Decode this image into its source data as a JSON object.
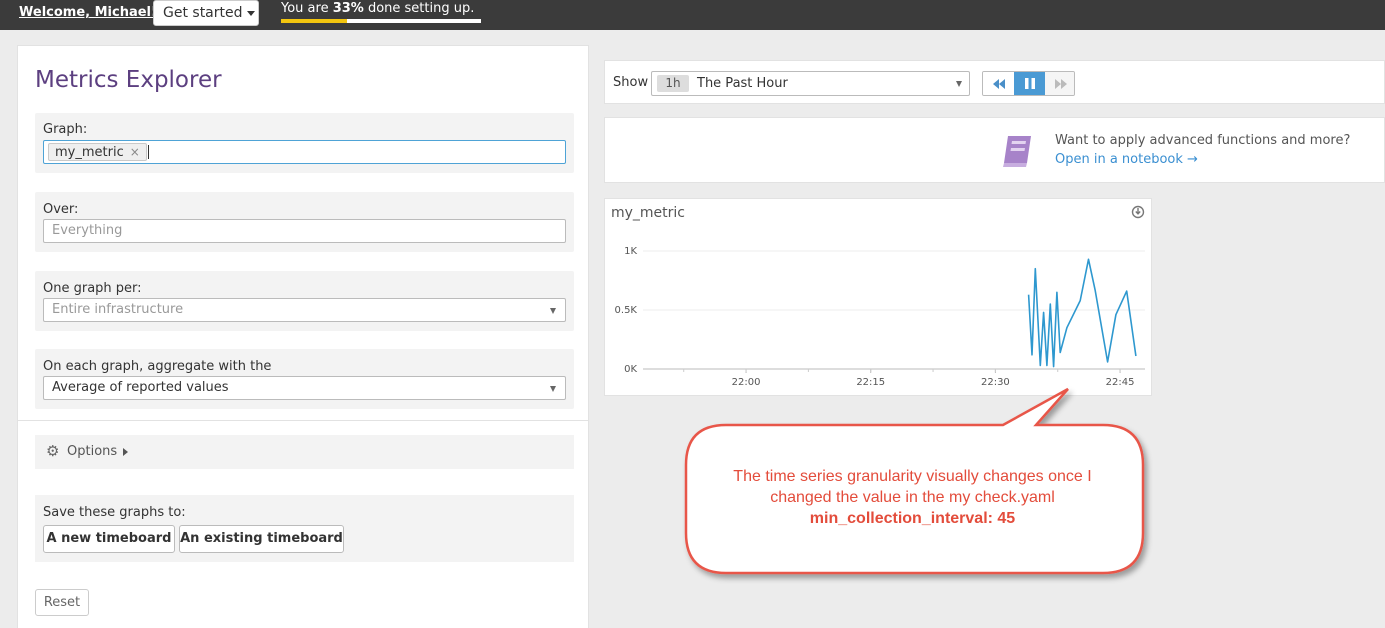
{
  "topbar": {
    "welcome": "Welcome, Michael!",
    "get_started": "Get started",
    "progress_prefix": "You are ",
    "progress_percent": "33%",
    "progress_suffix": " done setting up.",
    "progress_value": 0.33,
    "progress_color": "#f2c50f"
  },
  "explorer": {
    "title": "Metrics Explorer",
    "graph_label": "Graph:",
    "graph_token": "my_metric",
    "token_remove": "×",
    "over_label": "Over:",
    "over_placeholder": "Everything",
    "per_label": "One graph per:",
    "per_value": "Entire infrastructure",
    "aggregate_label": "On each graph, aggregate with the",
    "aggregate_value": "Average of reported values",
    "options_label": "Options",
    "save_label": "Save these graphs to:",
    "new_timeboard": "A new timeboard",
    "existing_timeboard": "An existing timeboard",
    "reset": "Reset"
  },
  "timebar": {
    "show_label": "Show",
    "badge": "1h",
    "range": "The Past Hour"
  },
  "notebook": {
    "prompt": "Want to apply advanced functions and more?",
    "link": "Open in a notebook →"
  },
  "graph": {
    "title": "my_metric"
  },
  "chart_data": {
    "type": "line",
    "title": "my_metric",
    "x_ticks": [
      "22:00",
      "22:15",
      "22:30",
      "22:45"
    ],
    "y_ticks": [
      "0K",
      "0.5K",
      "1K"
    ],
    "ylim": [
      0,
      1000
    ],
    "line_color": "#2e98cf",
    "series": [
      {
        "x": [
          "22:34",
          "22:34.4",
          "22:34.8",
          "22:35.4",
          "22:35.8",
          "22:36.2",
          "22:36.6",
          "22:37.0",
          "22:37.4",
          "22:37.8",
          "22:38.6",
          "22:40.2",
          "22:41.2",
          "22:42.0",
          "22:43.5",
          "22:44.5",
          "22:45.8",
          "22:46.9"
        ],
        "y": [
          630,
          120,
          850,
          30,
          480,
          30,
          550,
          20,
          650,
          140,
          350,
          580,
          930,
          670,
          60,
          460,
          660,
          110
        ]
      }
    ]
  },
  "annotation": {
    "line1": "The time series granularity visually changes once I",
    "line2": "changed the value in the my check.yaml",
    "line3": "min_collection_interval: 45",
    "color": "#e34c3b"
  }
}
